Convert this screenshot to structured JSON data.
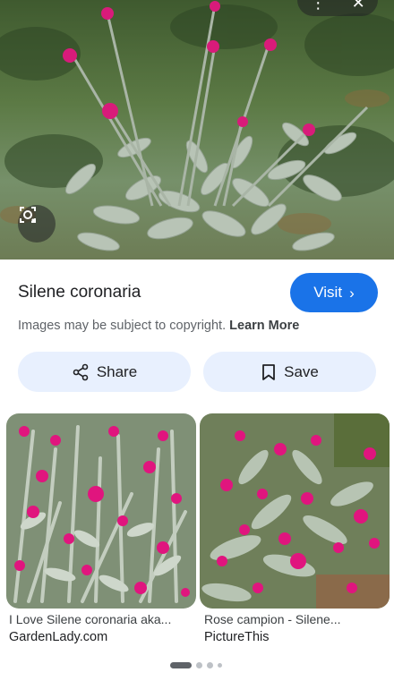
{
  "result": {
    "title": "Silene coronaria",
    "visit_label": "Visit",
    "copyright_text": "Images may be subject to copyright.",
    "learn_more": "Learn More"
  },
  "actions": {
    "share_label": "Share",
    "save_label": "Save"
  },
  "related": [
    {
      "caption": "I Love Silene coronaria aka...",
      "source": "GardenLady.com"
    },
    {
      "caption": "Rose campion - Silene...",
      "source": "PictureThis"
    }
  ],
  "pager": {
    "count": 4,
    "active_index": 0
  },
  "colors": {
    "accent": "#1a73e8",
    "chip_bg": "#e8f0fe",
    "flower_magenta": "#d81b7a",
    "foliage_silver": "#b8c4b6"
  },
  "icons": [
    "lens-icon",
    "more-icon",
    "close-icon",
    "chevron-right-icon",
    "share-icon",
    "bookmark-icon"
  ]
}
